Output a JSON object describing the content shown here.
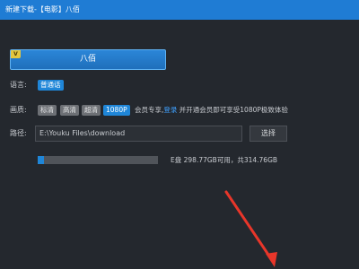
{
  "window": {
    "title": "新建下载-【电影】八佰"
  },
  "episode": {
    "badge": "V",
    "label": "八佰"
  },
  "language": {
    "label": "语言:",
    "selected": "普通话"
  },
  "quality": {
    "label": "画质:",
    "options": [
      "标清",
      "高清",
      "超清",
      "1080P"
    ],
    "selected": "1080P",
    "vip_prefix": "会员专享,",
    "login_link": "登录",
    "vip_suffix": " 并开通会员即可享受1080P极致体验"
  },
  "path": {
    "label": "路径:",
    "value": "E:\\Youku Files\\download",
    "choose_button": "选择"
  },
  "disk": {
    "used_fraction": 0.05,
    "info": "E盘 298.77GB可用，共314.76GB"
  },
  "colors": {
    "titlebar": "#1f7cd4",
    "background": "#24282e",
    "accent": "#1f86d8",
    "annotation_arrow": "#e8362a"
  },
  "icons": {
    "vip_badge": "vip-badge-icon",
    "annotation": "red-arrow-annotation"
  }
}
